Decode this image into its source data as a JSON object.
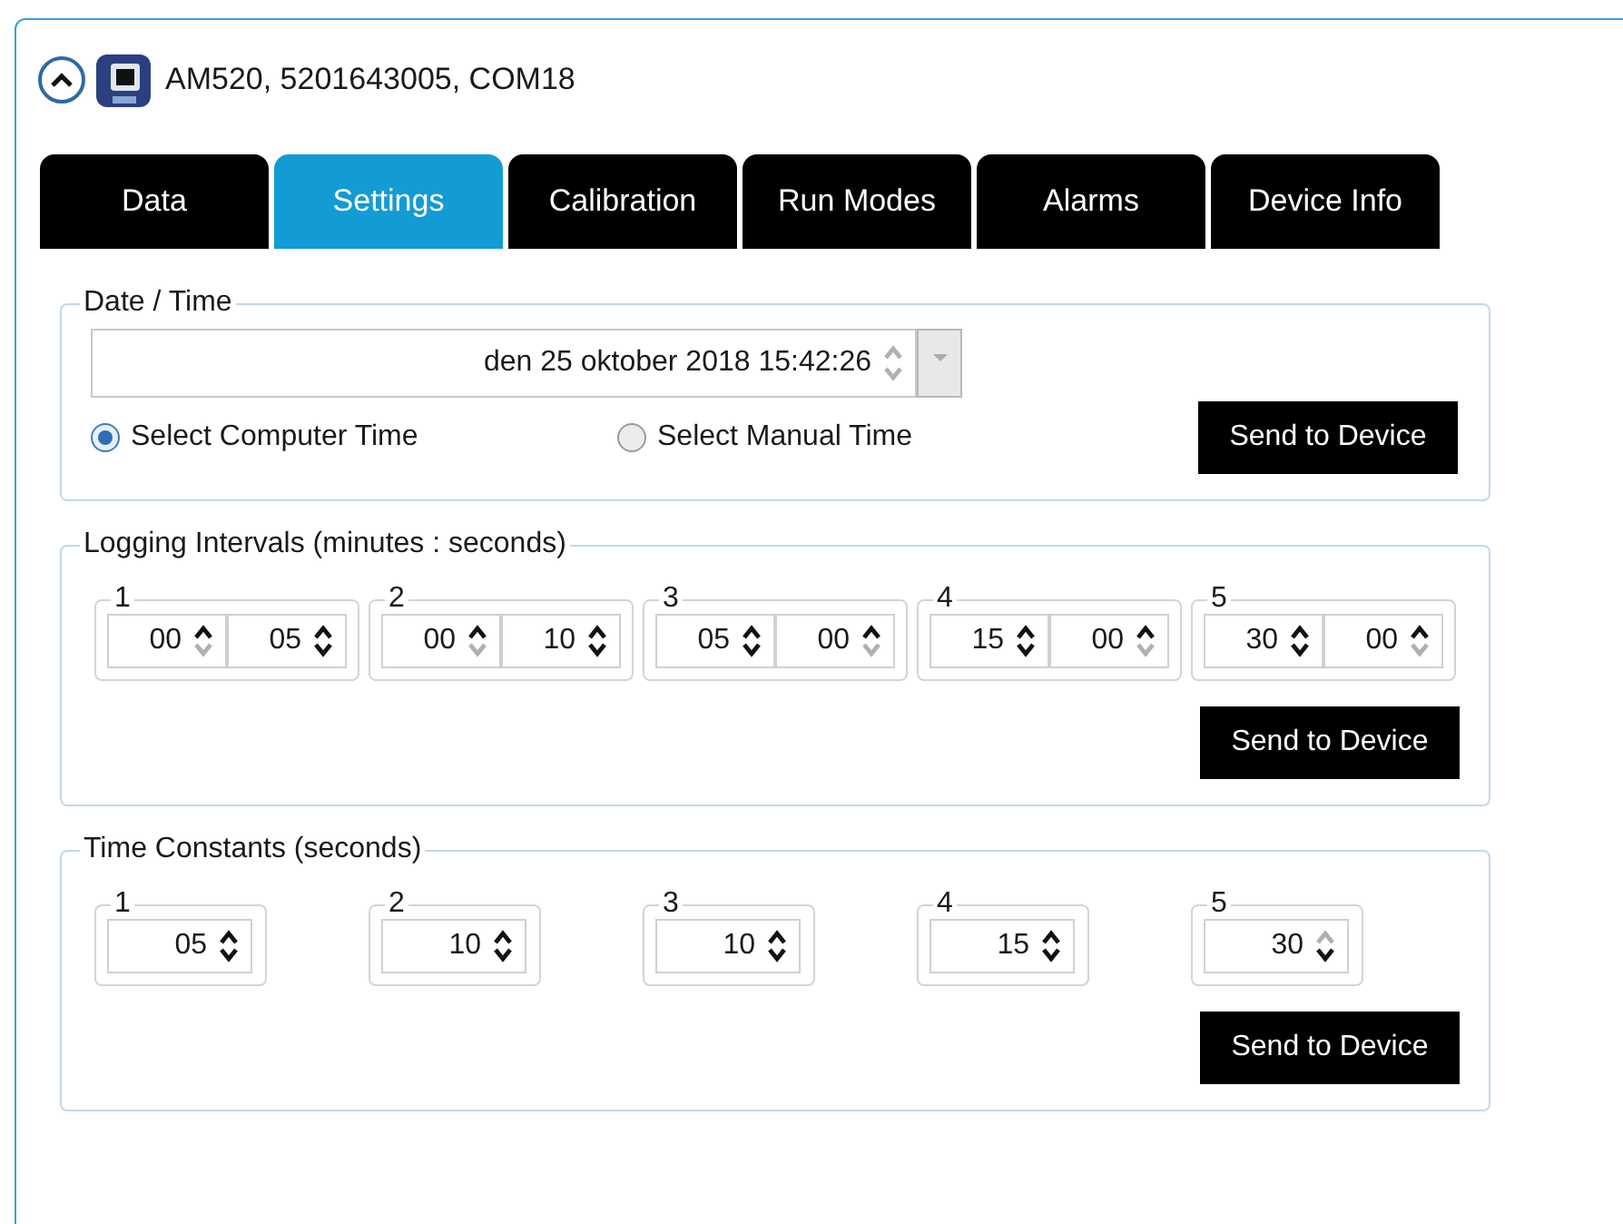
{
  "device": {
    "title": "AM520, 5201643005, COM18",
    "expanded": true
  },
  "tabs": [
    {
      "label": "Data",
      "selected": false
    },
    {
      "label": "Settings",
      "selected": true
    },
    {
      "label": "Calibration",
      "selected": false
    },
    {
      "label": "Run Modes",
      "selected": false
    },
    {
      "label": "Alarms",
      "selected": false
    },
    {
      "label": "Device Info",
      "selected": false
    }
  ],
  "date_time": {
    "title": "Date / Time",
    "value": "den 25 oktober 2018 15:42:26",
    "up_disabled": true,
    "down_disabled": true,
    "dropdown_disabled": true,
    "options": [
      {
        "label": "Select Computer Time",
        "selected": true
      },
      {
        "label": "Select Manual Time",
        "selected": false
      }
    ],
    "button": "Send to Device"
  },
  "logging_intervals": {
    "title": "Logging Intervals (minutes : seconds)",
    "button": "Send to Device",
    "items": [
      {
        "label": "1",
        "spinners": [
          {
            "value": "00",
            "up_disabled": false,
            "down_disabled": true
          },
          {
            "value": "05",
            "up_disabled": false,
            "down_disabled": false
          }
        ]
      },
      {
        "label": "2",
        "spinners": [
          {
            "value": "00",
            "up_disabled": false,
            "down_disabled": true
          },
          {
            "value": "10",
            "up_disabled": false,
            "down_disabled": false
          }
        ]
      },
      {
        "label": "3",
        "spinners": [
          {
            "value": "05",
            "up_disabled": false,
            "down_disabled": false
          },
          {
            "value": "00",
            "up_disabled": false,
            "down_disabled": true
          }
        ]
      },
      {
        "label": "4",
        "spinners": [
          {
            "value": "15",
            "up_disabled": false,
            "down_disabled": false
          },
          {
            "value": "00",
            "up_disabled": false,
            "down_disabled": true
          }
        ]
      },
      {
        "label": "5",
        "spinners": [
          {
            "value": "30",
            "up_disabled": false,
            "down_disabled": false
          },
          {
            "value": "00",
            "up_disabled": false,
            "down_disabled": true
          }
        ]
      }
    ]
  },
  "time_constants": {
    "title": "Time Constants (seconds)",
    "button": "Send to Device",
    "items": [
      {
        "label": "1",
        "spinners": [
          {
            "value": "05",
            "up_disabled": false,
            "down_disabled": false
          }
        ]
      },
      {
        "label": "2",
        "spinners": [
          {
            "value": "10",
            "up_disabled": false,
            "down_disabled": false
          }
        ]
      },
      {
        "label": "3",
        "spinners": [
          {
            "value": "10",
            "up_disabled": false,
            "down_disabled": false
          }
        ]
      },
      {
        "label": "4",
        "spinners": [
          {
            "value": "15",
            "up_disabled": false,
            "down_disabled": false
          }
        ]
      },
      {
        "label": "5",
        "spinners": [
          {
            "value": "30",
            "up_disabled": true,
            "down_disabled": false
          }
        ]
      }
    ]
  }
}
